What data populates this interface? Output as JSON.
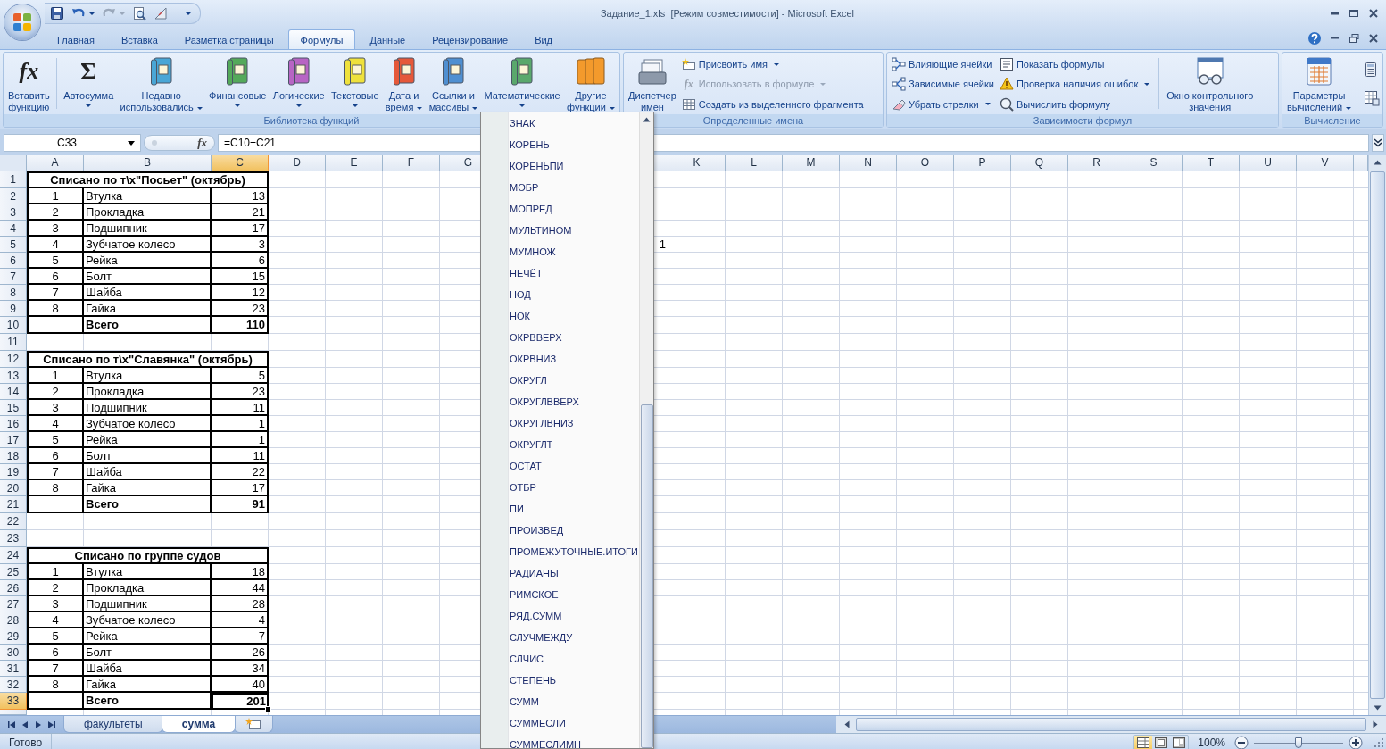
{
  "window": {
    "title": "Задание_1.xls  [Режим совместимости] - Microsoft Excel"
  },
  "tabs": [
    {
      "label": "Главная",
      "selected": false
    },
    {
      "label": "Вставка",
      "selected": false
    },
    {
      "label": "Разметка страницы",
      "selected": false
    },
    {
      "label": "Формулы",
      "selected": true
    },
    {
      "label": "Данные",
      "selected": false
    },
    {
      "label": "Рецензирование",
      "selected": false
    },
    {
      "label": "Вид",
      "selected": false
    }
  ],
  "ribbon": {
    "groups": [
      {
        "label": "Библиотека функций",
        "items": [
          {
            "kind": "fx",
            "label": "Вставить\nфункцию",
            "glyph": "fx"
          },
          {
            "kind": "separator"
          },
          {
            "kind": "sigma",
            "label": "Автосумма",
            "glyph": "Σ",
            "dropdown": true
          },
          {
            "kind": "book",
            "label": "Недавно\nиспользовались",
            "color": "#49a6d6",
            "dropdown": true
          },
          {
            "kind": "book",
            "label": "Финансовые",
            "color": "#54a95a",
            "dropdown": true
          },
          {
            "kind": "book",
            "label": "Логические",
            "color": "#b765c4",
            "dropdown": true
          },
          {
            "kind": "book",
            "label": "Текстовые",
            "color": "#efe13c",
            "dropdown": true
          },
          {
            "kind": "book",
            "label": "Дата и\nвремя",
            "color": "#e5583a",
            "dropdown": true
          },
          {
            "kind": "book",
            "label": "Ссылки и\nмассивы",
            "color": "#4f8fd1",
            "dropdown": true
          },
          {
            "kind": "book",
            "label": "Математические",
            "color": "#5aa86c",
            "dropdown": true
          },
          {
            "kind": "books",
            "label": "Другие\nфункции",
            "color": "#f39a2c",
            "dropdown": true
          }
        ]
      },
      {
        "label": "Определенные имена",
        "items": [
          {
            "kind": "cardfile",
            "label": "Диспетчер\nимен"
          },
          {
            "kind": "column",
            "buttons": [
              {
                "label": "Присвоить имя",
                "kind": "tag",
                "dropdown": true,
                "disabled": false
              },
              {
                "label": "Использовать в формуле",
                "kind": "fx",
                "glyph": "fx",
                "dropdown": true,
                "disabled": true
              },
              {
                "label": "Создать из выделенного фрагмента",
                "kind": "table",
                "dropdown": false,
                "disabled": false
              }
            ]
          }
        ]
      },
      {
        "label": "Зависимости формул",
        "items": [
          {
            "kind": "column",
            "buttons": [
              {
                "label": "Влияющие ячейки",
                "kind": "prec",
                "dropdown": false,
                "disabled": false
              },
              {
                "label": "Зависимые ячейки",
                "kind": "dep",
                "dropdown": false,
                "disabled": false
              },
              {
                "label": "Убрать стрелки",
                "kind": "erase",
                "dropdown": true,
                "disabled": false
              }
            ]
          },
          {
            "kind": "column",
            "buttons": [
              {
                "label": "Показать формулы",
                "kind": "showf",
                "dropdown": false,
                "disabled": false
              },
              {
                "label": "Проверка наличия ошибок",
                "kind": "err",
                "dropdown": true,
                "disabled": false
              },
              {
                "label": "Вычислить формулу",
                "kind": "eval",
                "dropdown": false,
                "disabled": false
              }
            ]
          },
          {
            "kind": "separator"
          },
          {
            "kind": "watch",
            "label": "Окно контрольного\nзначения"
          }
        ]
      },
      {
        "label": "Вычисление",
        "items": [
          {
            "kind": "calcopts",
            "label": "Параметры\nвычислений",
            "dropdown": true
          },
          {
            "kind": "icons"
          }
        ]
      }
    ]
  },
  "formula_bar": {
    "name_box": "C33",
    "fx": "fx",
    "formula": "=C10+C21"
  },
  "sheet": {
    "columns_before_menu": [
      {
        "label": "A",
        "selected": false
      },
      {
        "label": "B",
        "selected": false
      },
      {
        "label": "C",
        "selected": true
      },
      {
        "label": "D",
        "selected": false
      },
      {
        "label": "E",
        "selected": false
      },
      {
        "label": "F",
        "selected": false
      },
      {
        "label": "G",
        "selected": false
      }
    ],
    "columns_after_menu": [
      {
        "label": "K",
        "selected": false
      },
      {
        "label": "L",
        "selected": false
      },
      {
        "label": "M",
        "selected": false
      },
      {
        "label": "N",
        "selected": false
      },
      {
        "label": "O",
        "selected": false
      },
      {
        "label": "P",
        "selected": false
      },
      {
        "label": "Q",
        "selected": false
      },
      {
        "label": "R",
        "selected": false
      },
      {
        "label": "S",
        "selected": false
      },
      {
        "label": "T",
        "selected": false
      },
      {
        "label": "U",
        "selected": false
      },
      {
        "label": "V",
        "selected": false
      }
    ],
    "rows": [
      {
        "number": "1",
        "selected": false,
        "kind": "title",
        "text": "Списано по т\\х\"Посьет\" (октябрь)"
      },
      {
        "number": "2",
        "selected": false,
        "kind": "item",
        "cells": [
          "1",
          "Втулка",
          "13"
        ]
      },
      {
        "number": "3",
        "selected": false,
        "kind": "item",
        "cells": [
          "2",
          "Прокладка",
          "21"
        ]
      },
      {
        "number": "4",
        "selected": false,
        "kind": "item",
        "cells": [
          "3",
          "Подшипник",
          "17"
        ]
      },
      {
        "number": "5",
        "selected": false,
        "kind": "item",
        "cells": [
          "4",
          "Зубчатое колесо",
          "3"
        ],
        "far_value": "1"
      },
      {
        "number": "6",
        "selected": false,
        "kind": "item",
        "cells": [
          "5",
          "Рейка",
          "6"
        ]
      },
      {
        "number": "7",
        "selected": false,
        "kind": "item",
        "cells": [
          "6",
          "Болт",
          "15"
        ]
      },
      {
        "number": "8",
        "selected": false,
        "kind": "item",
        "cells": [
          "7",
          "Шайба",
          "12"
        ]
      },
      {
        "number": "9",
        "selected": false,
        "kind": "item",
        "cells": [
          "8",
          "Гайка",
          "23"
        ]
      },
      {
        "number": "10",
        "selected": false,
        "kind": "total",
        "cells": [
          "Всего",
          "110"
        ]
      },
      {
        "number": "11",
        "selected": false,
        "kind": "blank"
      },
      {
        "number": "12",
        "selected": false,
        "kind": "title",
        "text": "Списано по т\\х\"Славянка\" (октябрь)"
      },
      {
        "number": "13",
        "selected": false,
        "kind": "item",
        "cells": [
          "1",
          "Втулка",
          "5"
        ]
      },
      {
        "number": "14",
        "selected": false,
        "kind": "item",
        "cells": [
          "2",
          "Прокладка",
          "23"
        ]
      },
      {
        "number": "15",
        "selected": false,
        "kind": "item",
        "cells": [
          "3",
          "Подшипник",
          "11"
        ]
      },
      {
        "number": "16",
        "selected": false,
        "kind": "item",
        "cells": [
          "4",
          "Зубчатое колесо",
          "1"
        ]
      },
      {
        "number": "17",
        "selected": false,
        "kind": "item",
        "cells": [
          "5",
          "Рейка",
          "1"
        ]
      },
      {
        "number": "18",
        "selected": false,
        "kind": "item",
        "cells": [
          "6",
          "Болт",
          "11"
        ]
      },
      {
        "number": "19",
        "selected": false,
        "kind": "item",
        "cells": [
          "7",
          "Шайба",
          "22"
        ]
      },
      {
        "number": "20",
        "selected": false,
        "kind": "item",
        "cells": [
          "8",
          "Гайка",
          "17"
        ]
      },
      {
        "number": "21",
        "selected": false,
        "kind": "total",
        "cells": [
          "Всего",
          "91"
        ]
      },
      {
        "number": "22",
        "selected": false,
        "kind": "blank"
      },
      {
        "number": "23",
        "selected": false,
        "kind": "blank"
      },
      {
        "number": "24",
        "selected": false,
        "kind": "title",
        "text": "Списано по группе судов"
      },
      {
        "number": "25",
        "selected": false,
        "kind": "item",
        "cells": [
          "1",
          "Втулка",
          "18"
        ]
      },
      {
        "number": "26",
        "selected": false,
        "kind": "item",
        "cells": [
          "2",
          "Прокладка",
          "44"
        ]
      },
      {
        "number": "27",
        "selected": false,
        "kind": "item",
        "cells": [
          "3",
          "Подшипник",
          "28"
        ]
      },
      {
        "number": "28",
        "selected": false,
        "kind": "item",
        "cells": [
          "4",
          "Зубчатое колесо",
          "4"
        ]
      },
      {
        "number": "29",
        "selected": false,
        "kind": "item",
        "cells": [
          "5",
          "Рейка",
          "7"
        ]
      },
      {
        "number": "30",
        "selected": false,
        "kind": "item",
        "cells": [
          "6",
          "Болт",
          "26"
        ]
      },
      {
        "number": "31",
        "selected": false,
        "kind": "item",
        "cells": [
          "7",
          "Шайба",
          "34"
        ]
      },
      {
        "number": "32",
        "selected": false,
        "kind": "item",
        "cells": [
          "8",
          "Гайка",
          "40"
        ]
      },
      {
        "number": "33",
        "selected": true,
        "kind": "total",
        "cells": [
          "Всего",
          "201"
        ]
      }
    ]
  },
  "sheet_tabs": [
    {
      "label": "факультеты",
      "selected": false
    },
    {
      "label": "сумма",
      "selected": true
    }
  ],
  "status_bar": {
    "status": "Готово",
    "views": [
      {
        "kind": "normal",
        "selected": true
      },
      {
        "kind": "layout",
        "selected": false
      },
      {
        "kind": "pagebreak",
        "selected": false
      }
    ],
    "zoom": {
      "reading": "100%",
      "level": 0.5
    }
  },
  "function_menu": {
    "items": [
      "ЗНАК",
      "КОРЕНЬ",
      "КОРЕНЬПИ",
      "МОБР",
      "МОПРЕД",
      "МУЛЬТИНОМ",
      "МУМНОЖ",
      "НЕЧЁТ",
      "НОД",
      "НОК",
      "ОКРВВЕРХ",
      "ОКРВНИЗ",
      "ОКРУГЛ",
      "ОКРУГЛВВЕРХ",
      "ОКРУГЛВНИЗ",
      "ОКРУГЛТ",
      "ОСТАТ",
      "ОТБР",
      "ПИ",
      "ПРОИЗВЕД",
      "ПРОМЕЖУТОЧНЫЕ.ИТОГИ",
      "РАДИАНЫ",
      "РИМСКОЕ",
      "РЯД.СУММ",
      "СЛУЧМЕЖДУ",
      "СЛЧИС",
      "СТЕПЕНЬ",
      "СУММ",
      "СУММЕСЛИ",
      "СУММЕСЛИМН"
    ]
  }
}
